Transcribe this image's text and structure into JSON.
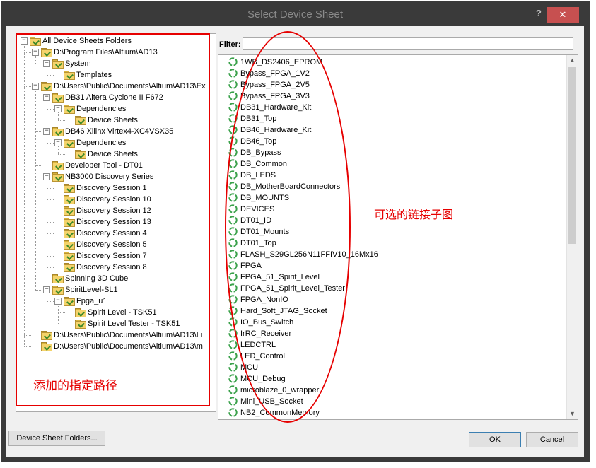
{
  "window": {
    "title": "Select Device Sheet",
    "help": "?",
    "close": "✕"
  },
  "filter": {
    "label": "Filter:",
    "value": ""
  },
  "tree": [
    {
      "label": "All Device Sheets Folders",
      "level": 0,
      "expanded": true
    },
    {
      "label": "D:\\Program Files\\Altium\\AD13",
      "level": 1,
      "expanded": true
    },
    {
      "label": "System",
      "level": 2,
      "expanded": true
    },
    {
      "label": "Templates",
      "level": 3,
      "expanded": null
    },
    {
      "label": "D:\\Users\\Public\\Documents\\Altium\\AD13\\Ex",
      "level": 1,
      "expanded": true
    },
    {
      "label": "DB31 Altera Cyclone II F672",
      "level": 2,
      "expanded": true
    },
    {
      "label": "Dependencies",
      "level": 3,
      "expanded": true
    },
    {
      "label": "Device Sheets",
      "level": 4,
      "expanded": null
    },
    {
      "label": "DB46 Xilinx Virtex4-XC4VSX35",
      "level": 2,
      "expanded": true
    },
    {
      "label": "Dependencies",
      "level": 3,
      "expanded": true
    },
    {
      "label": "Device Sheets",
      "level": 4,
      "expanded": null
    },
    {
      "label": "Developer Tool - DT01",
      "level": 2,
      "expanded": null
    },
    {
      "label": "NB3000 Discovery Series",
      "level": 2,
      "expanded": true
    },
    {
      "label": "Discovery Session 1",
      "level": 3,
      "expanded": null
    },
    {
      "label": "Discovery Session 10",
      "level": 3,
      "expanded": null
    },
    {
      "label": "Discovery Session 12",
      "level": 3,
      "expanded": null
    },
    {
      "label": "Discovery Session 13",
      "level": 3,
      "expanded": null
    },
    {
      "label": "Discovery Session 4",
      "level": 3,
      "expanded": null
    },
    {
      "label": "Discovery Session 5",
      "level": 3,
      "expanded": null
    },
    {
      "label": "Discovery Session 7",
      "level": 3,
      "expanded": null
    },
    {
      "label": "Discovery Session 8",
      "level": 3,
      "expanded": null
    },
    {
      "label": "Spinning 3D Cube",
      "level": 2,
      "expanded": null
    },
    {
      "label": "SpiritLevel-SL1",
      "level": 2,
      "expanded": true
    },
    {
      "label": "Fpga_u1",
      "level": 3,
      "expanded": true
    },
    {
      "label": "Spirit Level - TSK51",
      "level": 4,
      "expanded": null
    },
    {
      "label": "Spirit Level Tester - TSK51",
      "level": 4,
      "expanded": null
    },
    {
      "label": "D:\\Users\\Public\\Documents\\Altium\\AD13\\Li",
      "level": 1,
      "expanded": null
    },
    {
      "label": "D:\\Users\\Public\\Documents\\Altium\\AD13\\m",
      "level": 1,
      "expanded": null
    }
  ],
  "sheets": [
    "1WB_DS2406_EPROM",
    "Bypass_FPGA_1V2",
    "Bypass_FPGA_2V5",
    "Bypass_FPGA_3V3",
    "DB31_Hardware_Kit",
    "DB31_Top",
    "DB46_Hardware_Kit",
    "DB46_Top",
    "DB_Bypass",
    "DB_Common",
    "DB_LEDS",
    "DB_MotherBoardConnectors",
    "DB_MOUNTS",
    "DEVICES",
    "DT01_ID",
    "DT01_Mounts",
    "DT01_Top",
    "FLASH_S29GL256N11FFIV10_16Mx16",
    "FPGA",
    "FPGA_51_Spirit_Level",
    "FPGA_51_Spirit_Level_Tester",
    "FPGA_NonIO",
    "Hard_Soft_JTAG_Socket",
    "IO_Bus_Switch",
    "IrRC_Receiver",
    "LEDCTRL",
    "LED_Control",
    "MCU",
    "MCU_Debug",
    "microblaze_0_wrapper",
    "Mini_USB_Socket",
    "NB2_CommonMemory"
  ],
  "scrollbar": {
    "up": "▲",
    "down": "▼"
  },
  "buttons": {
    "folders": "Device Sheet Folders...",
    "ok": "OK",
    "cancel": "Cancel"
  },
  "annotations": {
    "left": "添加的指定路径",
    "right": "可选的链接子图"
  },
  "colors": {
    "annotation": "#e60000",
    "titlebar": "#3a3a3a",
    "close": "#c75050"
  }
}
